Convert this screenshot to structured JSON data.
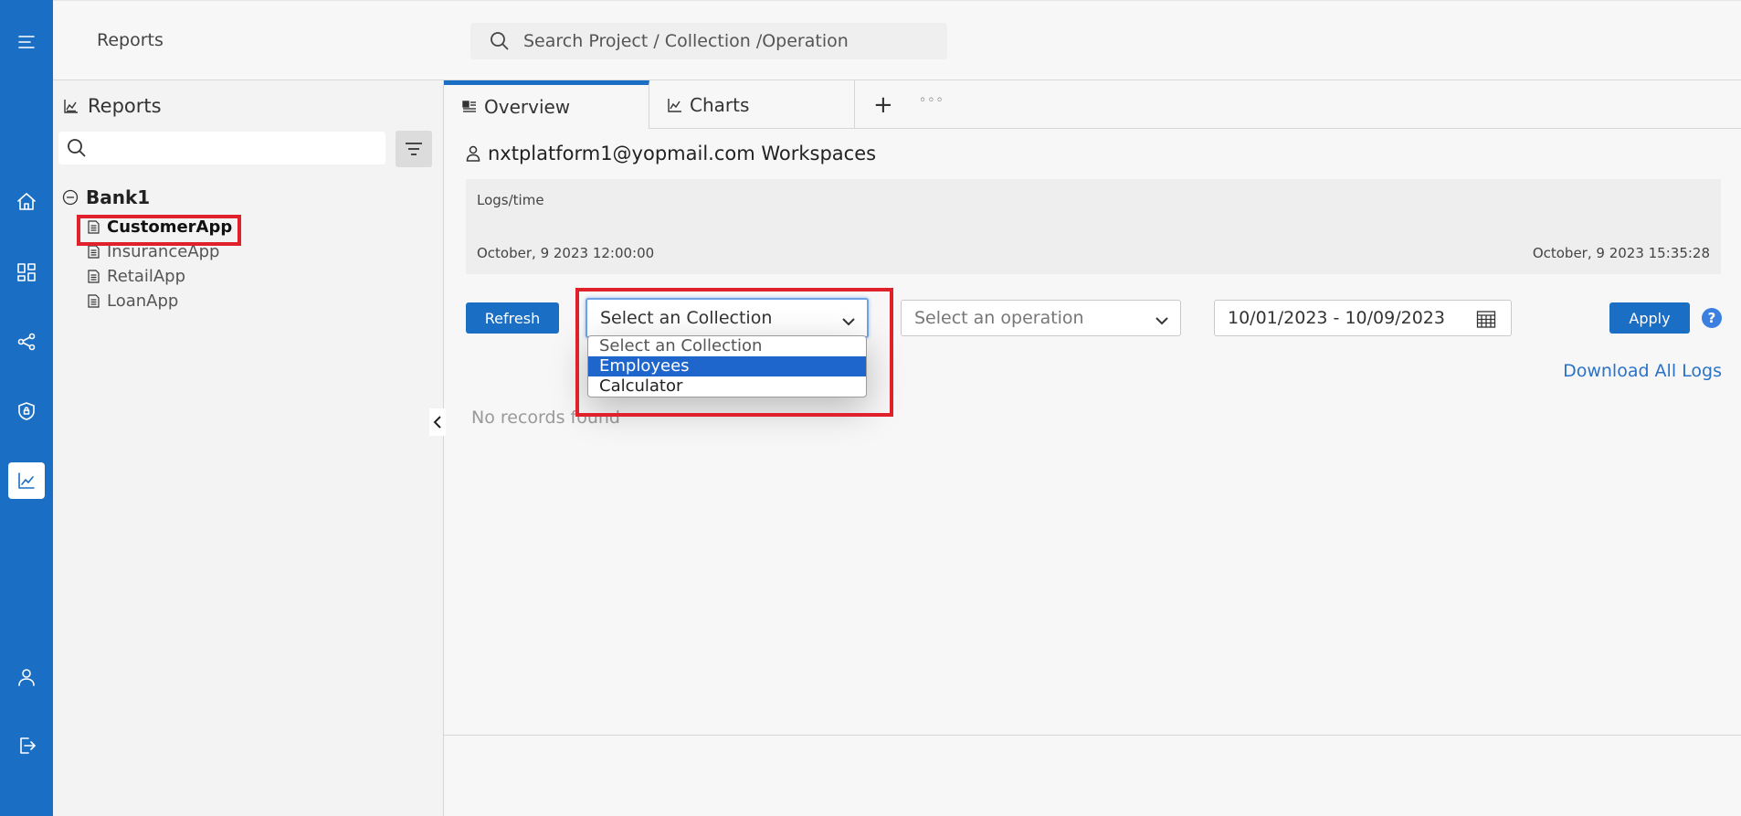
{
  "header": {
    "app_title": "Reports",
    "search_placeholder": "Search Project / Collection /Operation"
  },
  "nav": {
    "items": [
      "menu-icon",
      "home-icon",
      "dashboard-icon",
      "share-icon",
      "shield-icon",
      "chart-icon",
      "user-icon",
      "logout-icon"
    ],
    "active": "chart-icon"
  },
  "sidebar": {
    "title": "Reports",
    "search_value": "",
    "tree": {
      "root": "Bank1",
      "children": [
        {
          "label": "CustomerApp",
          "selected": true
        },
        {
          "label": "InsuranceApp",
          "selected": false
        },
        {
          "label": "RetailApp",
          "selected": false
        },
        {
          "label": "LoanApp",
          "selected": false
        }
      ]
    }
  },
  "tabs": [
    {
      "label": "Overview",
      "active": true
    },
    {
      "label": "Charts",
      "active": false
    }
  ],
  "workspace": {
    "label": "nxtplatform1@yopmail.com Workspaces"
  },
  "logs": {
    "title": "Logs/time",
    "start": "October, 9 2023 12:00:00",
    "end": "October, 9 2023 15:35:28"
  },
  "controls": {
    "refresh_label": "Refresh",
    "collection_select": {
      "value": "Select an Collection",
      "options": [
        "Select an Collection",
        "Employees",
        "Calculator"
      ],
      "highlighted": "Employees"
    },
    "operation_select": {
      "value": "Select an operation"
    },
    "date_range": "10/01/2023 - 10/09/2023",
    "apply_label": "Apply",
    "help_label": "?",
    "download_label": "Download All Logs"
  },
  "results": {
    "empty_message": "No records found"
  },
  "colors": {
    "brand": "#1a6fc4",
    "highlight_box": "#e0202a",
    "option_selected": "#1f66cc"
  }
}
